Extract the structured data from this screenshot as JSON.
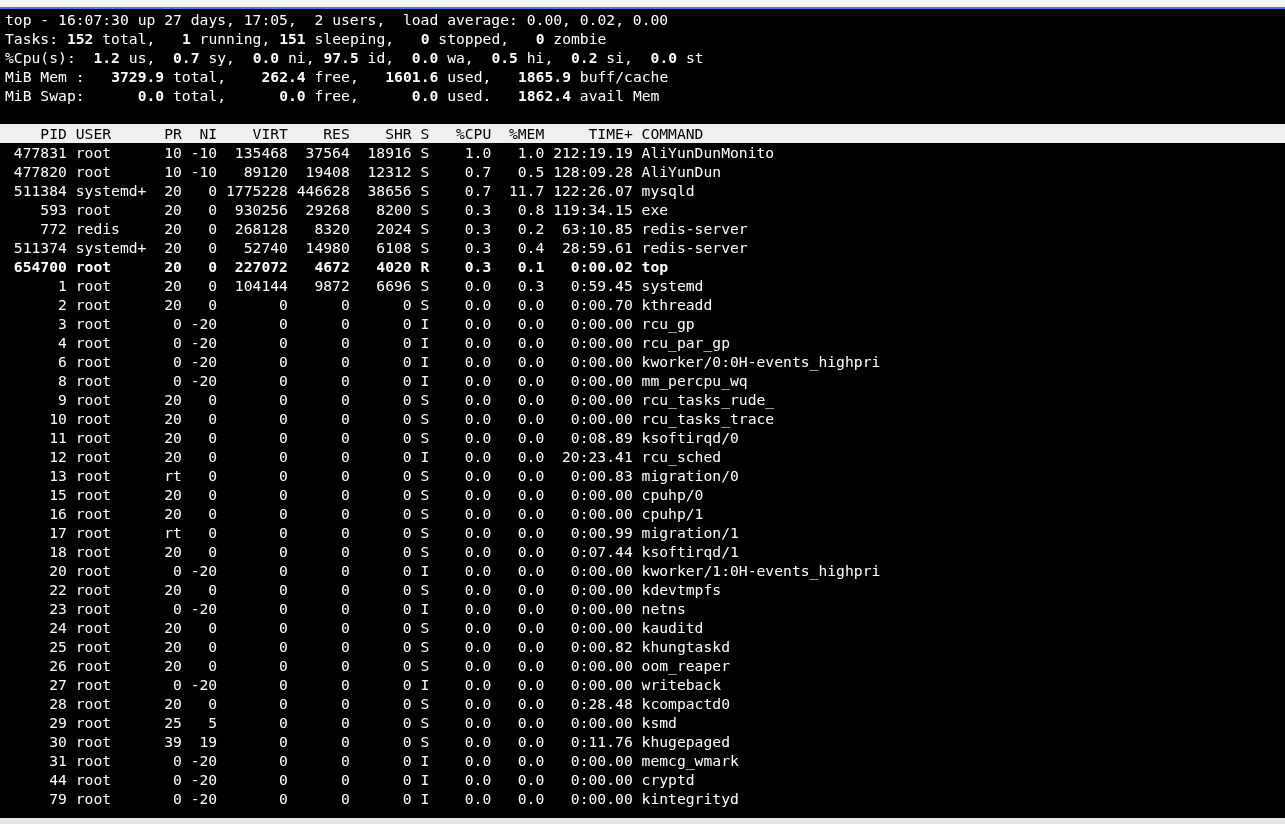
{
  "summary_lines": [
    "top - 16:07:30 up 27 days, 17:05,  2 users,  load average: 0.00, 0.02, 0.00",
    "Tasks: **152** total,   **1** running, **151** sleeping,   **0** stopped,   **0** zombie",
    "%Cpu(s):  **1.2** us,  **0.7** sy,  **0.0** ni, **97.5** id,  **0.0** wa,  **0.5** hi,  **0.2** si,  **0.0** st",
    "MiB Mem :   **3729.9** total,    **262.4** free,   **1601.6** used,   **1865.9** buff/cache",
    "MiB Swap:      **0.0** total,      **0.0** free,      **0.0** used.   **1862.4** avail Mem"
  ],
  "table": {
    "columns": [
      "PID",
      "USER",
      "PR",
      "NI",
      "VIRT",
      "RES",
      "SHR",
      "S",
      "%CPU",
      "%MEM",
      "TIME+",
      "COMMAND"
    ],
    "rows": [
      {
        "bold": false,
        "cells": [
          "477831",
          "root",
          "10",
          "-10",
          "135468",
          "37564",
          "18916",
          "S",
          "1.0",
          "1.0",
          "212:19.19",
          "AliYunDunMonito"
        ]
      },
      {
        "bold": false,
        "cells": [
          "477820",
          "root",
          "10",
          "-10",
          "89120",
          "19408",
          "12312",
          "S",
          "0.7",
          "0.5",
          "128:09.28",
          "AliYunDun"
        ]
      },
      {
        "bold": false,
        "cells": [
          "511384",
          "systemd+",
          "20",
          "0",
          "1775228",
          "446628",
          "38656",
          "S",
          "0.7",
          "11.7",
          "122:26.07",
          "mysqld"
        ]
      },
      {
        "bold": false,
        "cells": [
          "593",
          "root",
          "20",
          "0",
          "930256",
          "29268",
          "8200",
          "S",
          "0.3",
          "0.8",
          "119:34.15",
          "exe"
        ]
      },
      {
        "bold": false,
        "cells": [
          "772",
          "redis",
          "20",
          "0",
          "268128",
          "8320",
          "2024",
          "S",
          "0.3",
          "0.2",
          "63:10.85",
          "redis-server"
        ]
      },
      {
        "bold": false,
        "cells": [
          "511374",
          "systemd+",
          "20",
          "0",
          "52740",
          "14980",
          "6108",
          "S",
          "0.3",
          "0.4",
          "28:59.61",
          "redis-server"
        ]
      },
      {
        "bold": true,
        "cells": [
          "654700",
          "root",
          "20",
          "0",
          "227072",
          "4672",
          "4020",
          "R",
          "0.3",
          "0.1",
          "0:00.02",
          "top"
        ]
      },
      {
        "bold": false,
        "cells": [
          "1",
          "root",
          "20",
          "0",
          "104144",
          "9872",
          "6696",
          "S",
          "0.0",
          "0.3",
          "0:59.45",
          "systemd"
        ]
      },
      {
        "bold": false,
        "cells": [
          "2",
          "root",
          "20",
          "0",
          "0",
          "0",
          "0",
          "S",
          "0.0",
          "0.0",
          "0:00.70",
          "kthreadd"
        ]
      },
      {
        "bold": false,
        "cells": [
          "3",
          "root",
          "0",
          "-20",
          "0",
          "0",
          "0",
          "I",
          "0.0",
          "0.0",
          "0:00.00",
          "rcu_gp"
        ]
      },
      {
        "bold": false,
        "cells": [
          "4",
          "root",
          "0",
          "-20",
          "0",
          "0",
          "0",
          "I",
          "0.0",
          "0.0",
          "0:00.00",
          "rcu_par_gp"
        ]
      },
      {
        "bold": false,
        "cells": [
          "6",
          "root",
          "0",
          "-20",
          "0",
          "0",
          "0",
          "I",
          "0.0",
          "0.0",
          "0:00.00",
          "kworker/0:0H-events_highpri"
        ]
      },
      {
        "bold": false,
        "cells": [
          "8",
          "root",
          "0",
          "-20",
          "0",
          "0",
          "0",
          "I",
          "0.0",
          "0.0",
          "0:00.00",
          "mm_percpu_wq"
        ]
      },
      {
        "bold": false,
        "cells": [
          "9",
          "root",
          "20",
          "0",
          "0",
          "0",
          "0",
          "S",
          "0.0",
          "0.0",
          "0:00.00",
          "rcu_tasks_rude_"
        ]
      },
      {
        "bold": false,
        "cells": [
          "10",
          "root",
          "20",
          "0",
          "0",
          "0",
          "0",
          "S",
          "0.0",
          "0.0",
          "0:00.00",
          "rcu_tasks_trace"
        ]
      },
      {
        "bold": false,
        "cells": [
          "11",
          "root",
          "20",
          "0",
          "0",
          "0",
          "0",
          "S",
          "0.0",
          "0.0",
          "0:08.89",
          "ksoftirqd/0"
        ]
      },
      {
        "bold": false,
        "cells": [
          "12",
          "root",
          "20",
          "0",
          "0",
          "0",
          "0",
          "I",
          "0.0",
          "0.0",
          "20:23.41",
          "rcu_sched"
        ]
      },
      {
        "bold": false,
        "cells": [
          "13",
          "root",
          "rt",
          "0",
          "0",
          "0",
          "0",
          "S",
          "0.0",
          "0.0",
          "0:00.83",
          "migration/0"
        ]
      },
      {
        "bold": false,
        "cells": [
          "15",
          "root",
          "20",
          "0",
          "0",
          "0",
          "0",
          "S",
          "0.0",
          "0.0",
          "0:00.00",
          "cpuhp/0"
        ]
      },
      {
        "bold": false,
        "cells": [
          "16",
          "root",
          "20",
          "0",
          "0",
          "0",
          "0",
          "S",
          "0.0",
          "0.0",
          "0:00.00",
          "cpuhp/1"
        ]
      },
      {
        "bold": false,
        "cells": [
          "17",
          "root",
          "rt",
          "0",
          "0",
          "0",
          "0",
          "S",
          "0.0",
          "0.0",
          "0:00.99",
          "migration/1"
        ]
      },
      {
        "bold": false,
        "cells": [
          "18",
          "root",
          "20",
          "0",
          "0",
          "0",
          "0",
          "S",
          "0.0",
          "0.0",
          "0:07.44",
          "ksoftirqd/1"
        ]
      },
      {
        "bold": false,
        "cells": [
          "20",
          "root",
          "0",
          "-20",
          "0",
          "0",
          "0",
          "I",
          "0.0",
          "0.0",
          "0:00.00",
          "kworker/1:0H-events_highpri"
        ]
      },
      {
        "bold": false,
        "cells": [
          "22",
          "root",
          "20",
          "0",
          "0",
          "0",
          "0",
          "S",
          "0.0",
          "0.0",
          "0:00.00",
          "kdevtmpfs"
        ]
      },
      {
        "bold": false,
        "cells": [
          "23",
          "root",
          "0",
          "-20",
          "0",
          "0",
          "0",
          "I",
          "0.0",
          "0.0",
          "0:00.00",
          "netns"
        ]
      },
      {
        "bold": false,
        "cells": [
          "24",
          "root",
          "20",
          "0",
          "0",
          "0",
          "0",
          "S",
          "0.0",
          "0.0",
          "0:00.00",
          "kauditd"
        ]
      },
      {
        "bold": false,
        "cells": [
          "25",
          "root",
          "20",
          "0",
          "0",
          "0",
          "0",
          "S",
          "0.0",
          "0.0",
          "0:00.82",
          "khungtaskd"
        ]
      },
      {
        "bold": false,
        "cells": [
          "26",
          "root",
          "20",
          "0",
          "0",
          "0",
          "0",
          "S",
          "0.0",
          "0.0",
          "0:00.00",
          "oom_reaper"
        ]
      },
      {
        "bold": false,
        "cells": [
          "27",
          "root",
          "0",
          "-20",
          "0",
          "0",
          "0",
          "I",
          "0.0",
          "0.0",
          "0:00.00",
          "writeback"
        ]
      },
      {
        "bold": false,
        "cells": [
          "28",
          "root",
          "20",
          "0",
          "0",
          "0",
          "0",
          "S",
          "0.0",
          "0.0",
          "0:28.48",
          "kcompactd0"
        ]
      },
      {
        "bold": false,
        "cells": [
          "29",
          "root",
          "25",
          "5",
          "0",
          "0",
          "0",
          "S",
          "0.0",
          "0.0",
          "0:00.00",
          "ksmd"
        ]
      },
      {
        "bold": false,
        "cells": [
          "30",
          "root",
          "39",
          "19",
          "0",
          "0",
          "0",
          "S",
          "0.0",
          "0.0",
          "0:11.76",
          "khugepaged"
        ]
      },
      {
        "bold": false,
        "cells": [
          "31",
          "root",
          "0",
          "-20",
          "0",
          "0",
          "0",
          "I",
          "0.0",
          "0.0",
          "0:00.00",
          "memcg_wmark"
        ]
      },
      {
        "bold": false,
        "cells": [
          "44",
          "root",
          "0",
          "-20",
          "0",
          "0",
          "0",
          "I",
          "0.0",
          "0.0",
          "0:00.00",
          "cryptd"
        ]
      },
      {
        "bold": false,
        "cells": [
          "79",
          "root",
          "0",
          "-20",
          "0",
          "0",
          "0",
          "I",
          "0.0",
          "0.0",
          "0:00.00",
          "kintegrityd"
        ]
      }
    ]
  }
}
